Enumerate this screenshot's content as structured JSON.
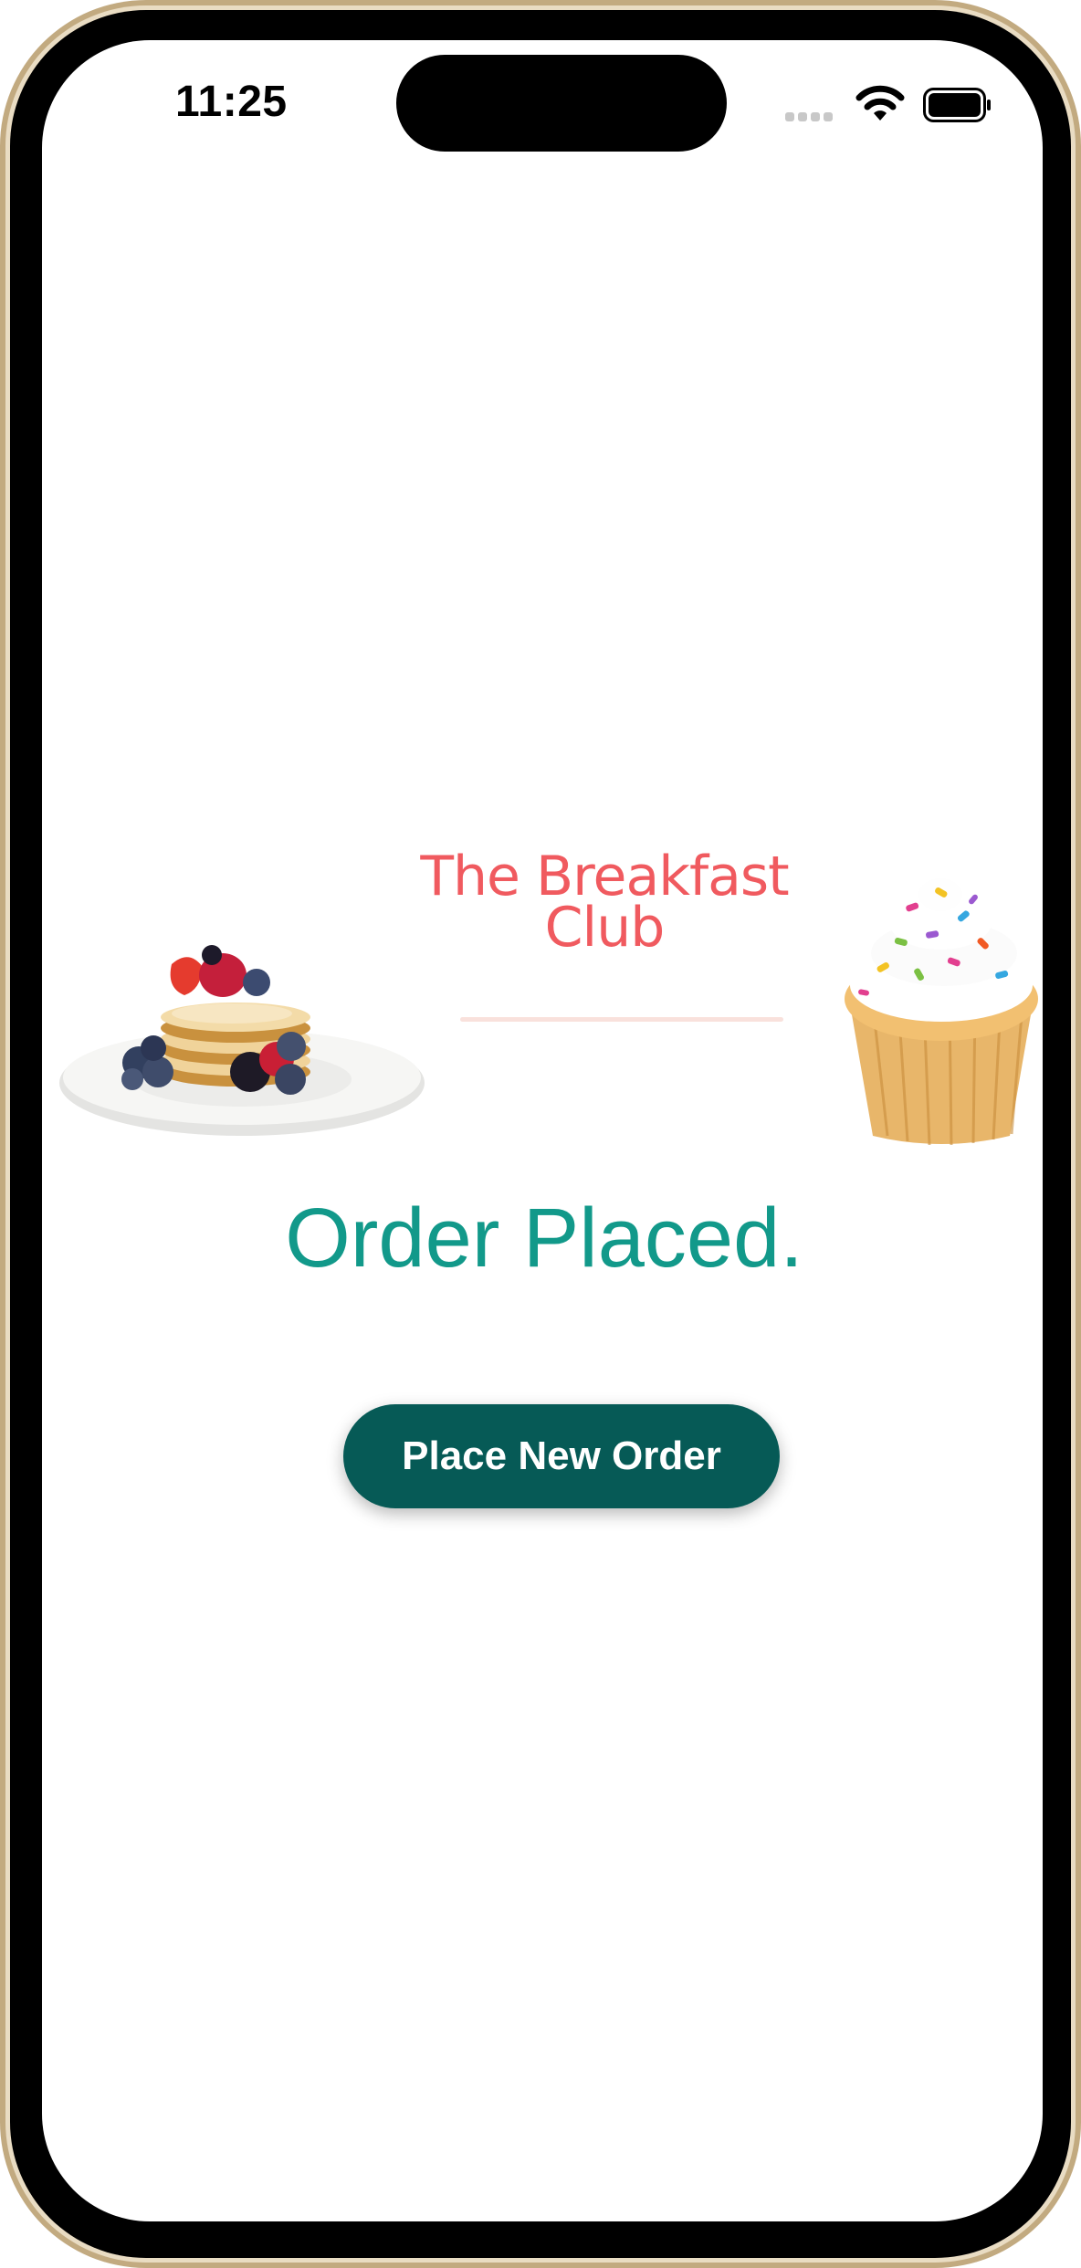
{
  "status_bar": {
    "time": "11:25",
    "icons": [
      "cellular-signal-icon",
      "wifi-icon",
      "battery-icon"
    ]
  },
  "brand": {
    "title": "The Breakfast Club",
    "color": "#f05a5f"
  },
  "images": {
    "left": "pancake-stack-image",
    "right": "cupcake-image"
  },
  "order": {
    "status_text": "Order Placed.",
    "status_color": "#12998a"
  },
  "actions": {
    "new_order_label": "Place New Order",
    "button_color": "#065a56"
  }
}
